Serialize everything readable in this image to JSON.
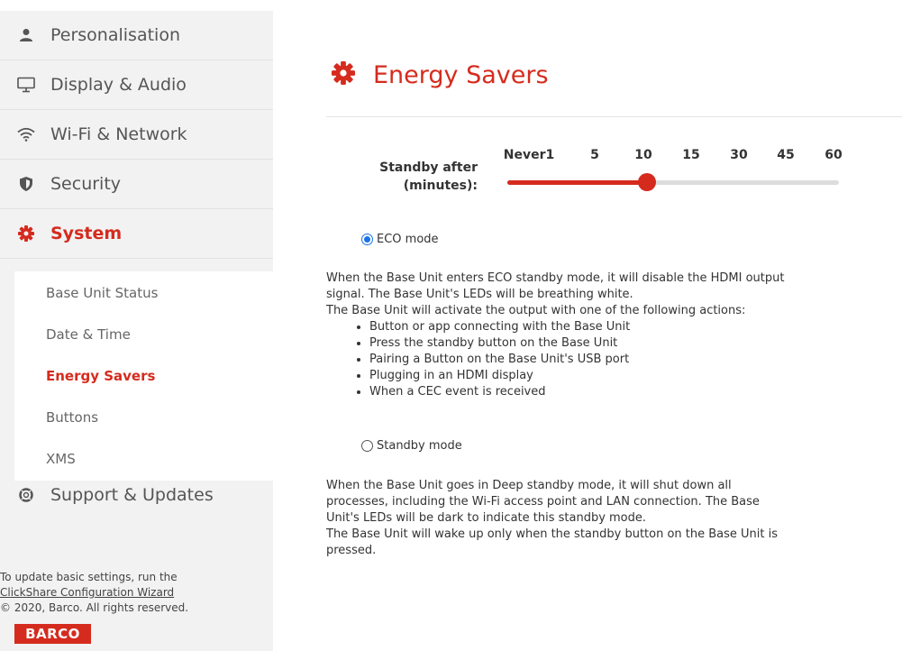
{
  "sidebar": {
    "items": [
      {
        "label": "Personalisation",
        "icon": "person-icon"
      },
      {
        "label": "Display & Audio",
        "icon": "monitor-icon"
      },
      {
        "label": "Wi-Fi & Network",
        "icon": "wifi-icon"
      },
      {
        "label": "Security",
        "icon": "shield-icon"
      },
      {
        "label": "System",
        "icon": "gear-icon"
      },
      {
        "label": "Support & Updates",
        "icon": "lifebuoy-icon"
      }
    ],
    "system_subitems": [
      "Base Unit Status",
      "Date & Time",
      "Energy Savers",
      "Buttons",
      "XMS"
    ],
    "active_item": "System",
    "active_subitem": "Energy Savers"
  },
  "footer": {
    "line1": "To update basic settings, run the",
    "link": "ClickShare Configuration Wizard",
    "copyright": "© 2020, Barco. All rights reserved.",
    "logo": "BARCO"
  },
  "main": {
    "title": "Energy Savers",
    "title_icon": "gear-icon",
    "standby": {
      "label_line1": "Standby after",
      "label_line2": "(minutes):",
      "ticks": [
        "Never1",
        "5",
        "10",
        "15",
        "30",
        "45",
        "60"
      ],
      "selected": "10"
    },
    "eco": {
      "label": "ECO mode",
      "checked": true,
      "desc_line1": "When the Base Unit enters ECO standby mode, it will disable the HDMI output",
      "desc_line2": "signal. The Base Unit's LEDs will be breathing white.",
      "desc_line3": "The Base Unit will activate the output with one of the following actions:",
      "actions": [
        "Button or app connecting with the Base Unit",
        "Press the standby button on the Base Unit",
        "Pairing a Button on the Base Unit's USB port",
        "Plugging in an HDMI display",
        "When a CEC event is received"
      ]
    },
    "standby_mode": {
      "label": "Standby mode",
      "checked": false,
      "desc_line1": "When the Base Unit goes in Deep standby mode, it will shut down all",
      "desc_line2": "processes, including the Wi-Fi access point and LAN connection. The Base",
      "desc_line3": "Unit's LEDs will be dark to indicate this standby mode.",
      "desc_line4": "The Base Unit will wake up only when the standby button on the Base Unit is",
      "desc_line5": "pressed."
    }
  },
  "colors": {
    "accent": "#d52b1e",
    "radio": "#1a73e8",
    "sidebar_bg": "#f2f2f2"
  }
}
